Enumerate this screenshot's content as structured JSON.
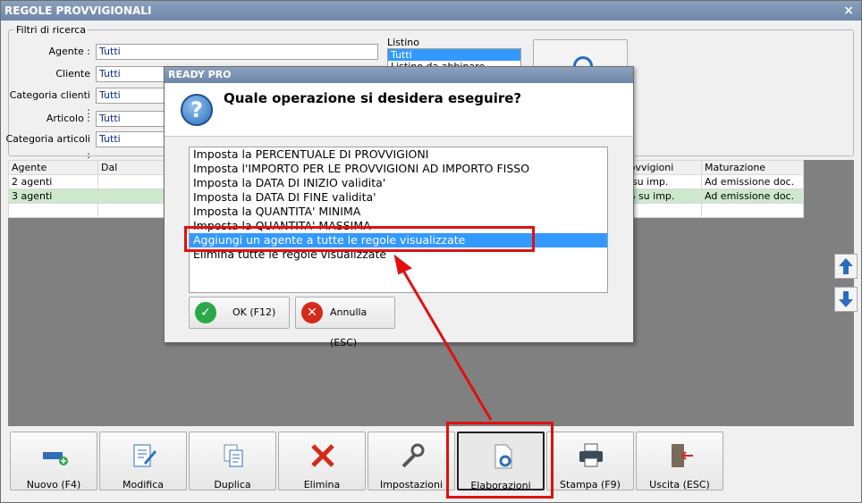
{
  "window": {
    "title": "REGOLE PROVVIGIONALI",
    "close": "×"
  },
  "filters": {
    "legend": "Filtri di ricerca",
    "rows": [
      {
        "label": "Agente :",
        "value": "Tutti"
      },
      {
        "label": "Cliente",
        "value": "Tutti"
      },
      {
        "label": "Categoria clienti :",
        "value": "Tutti"
      },
      {
        "label": "Articolo :",
        "value": "Tutti"
      },
      {
        "label": "Categoria articoli :",
        "value": "Tutti"
      }
    ],
    "listino_label": "Listino",
    "listino_selected": "Tutti",
    "listino_next": "Listino da abbinare"
  },
  "grid": {
    "headers": [
      "Agente",
      "Dal",
      "Provvigioni",
      "Maturazione"
    ],
    "rows": [
      {
        "agente": "2 agenti",
        "dal": "",
        "provvigioni": "% su imp.",
        "maturazione": "Ad emissione doc."
      },
      {
        "agente": "3 agenti",
        "dal": "",
        "provvigioni": "0% su imp.",
        "maturazione": "Ad emissione doc."
      }
    ]
  },
  "toolbar": [
    {
      "label": "Nuovo (F4)",
      "icon": "new-icon"
    },
    {
      "label": "Modifica",
      "icon": "edit-icon"
    },
    {
      "label": "Duplica",
      "icon": "duplicate-icon"
    },
    {
      "label": "Elimina",
      "icon": "delete-icon"
    },
    {
      "label": "Impostazioni",
      "icon": "wrench-icon"
    },
    {
      "label": "Elaborazioni",
      "icon": "process-icon"
    },
    {
      "label": "Stampa (F9)",
      "icon": "print-icon"
    },
    {
      "label": "Uscita (ESC)",
      "icon": "exit-icon"
    }
  ],
  "dialog": {
    "title": "READY PRO",
    "question": "Quale operazione si desidera eseguire?",
    "options": [
      "Imposta la PERCENTUALE DI PROVVIGIONI",
      "Imposta l'IMPORTO PER LE PROVVIGIONI AD IMPORTO FISSO",
      "Imposta la DATA DI INIZIO validita'",
      "Imposta la DATA DI FINE validita'",
      "Imposta la QUANTITA' MINIMA",
      "Imposta la QUANTITA' MASSIMA",
      "Aggiungi un agente a tutte le regole visualizzate",
      "Elimina tutte le regole visualizzate"
    ],
    "selected_index": 6,
    "ok_label": "OK (F12)",
    "cancel_label": "Annulla (ESC)"
  },
  "colors": {
    "accent_red": "#e01010",
    "selection_blue": "#3399ff",
    "title_blue": "#7890b0"
  }
}
